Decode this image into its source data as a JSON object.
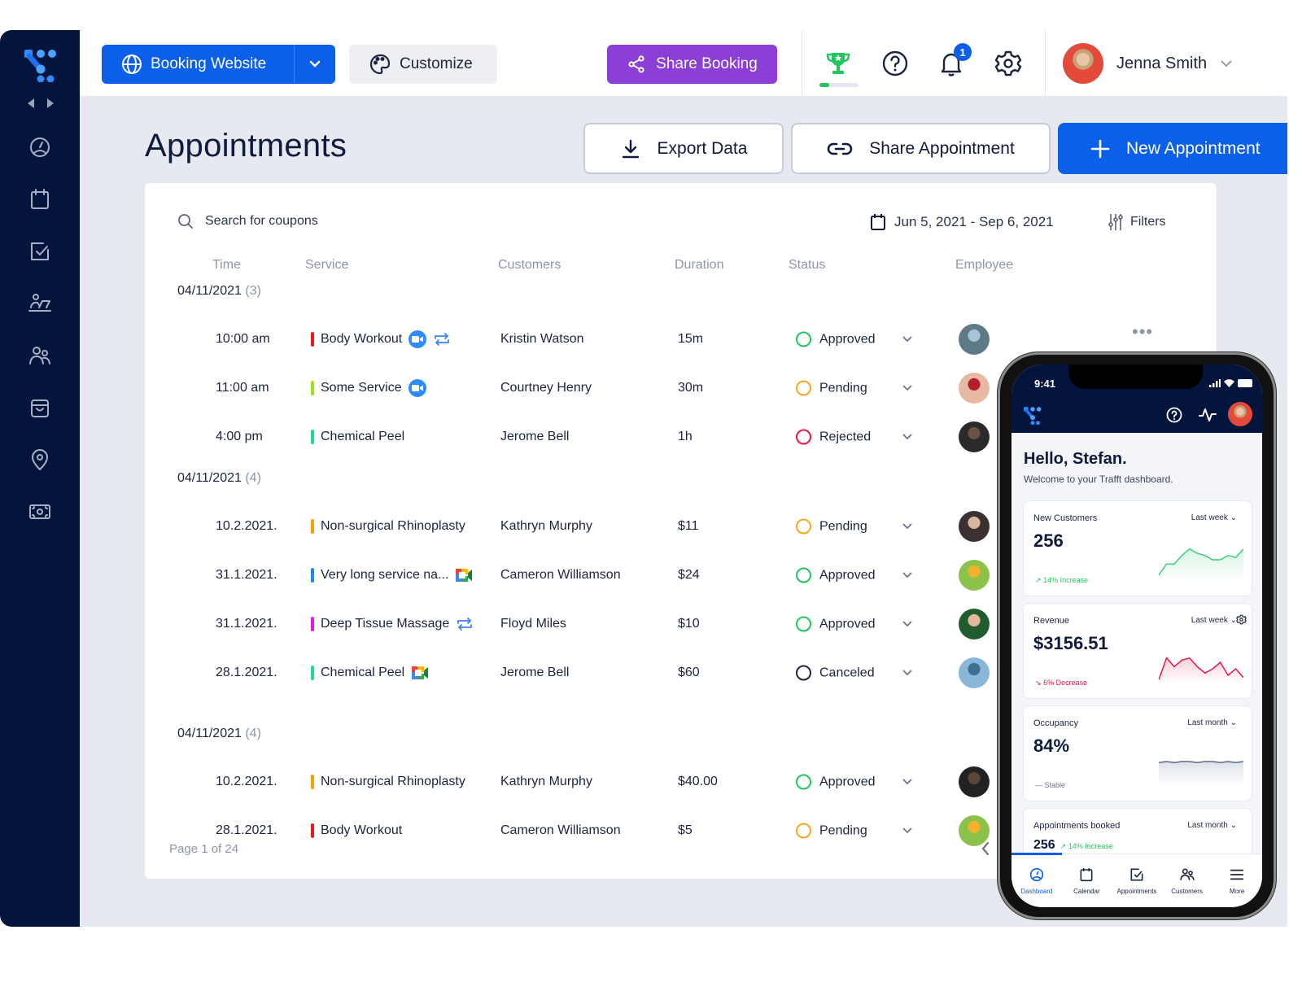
{
  "topbar": {
    "booking_website_label": "Booking Website",
    "customize_label": "Customize",
    "share_booking_label": "Share Booking",
    "achievement_progress": 0.25,
    "notification_count": "1",
    "user_name": "Jenna Smith"
  },
  "sidebar": {
    "items": [
      {
        "icon": "dashboard-gauge-icon"
      },
      {
        "icon": "calendar-icon"
      },
      {
        "icon": "appointments-check-icon"
      },
      {
        "icon": "employees-desk-icon"
      },
      {
        "icon": "customers-icon"
      },
      {
        "icon": "services-bag-icon"
      },
      {
        "icon": "location-pin-icon"
      },
      {
        "icon": "finance-money-icon"
      }
    ]
  },
  "page": {
    "title": "Appointments",
    "export_label": "Export Data",
    "share_appointment_label": "Share Appointment",
    "new_appointment_label": "New Appointment"
  },
  "toolbar": {
    "search_placeholder": "Search for coupons",
    "date_range": "Jun 5, 2021 - Sep 6, 2021",
    "filters_label": "Filters"
  },
  "table": {
    "columns": [
      "Time",
      "Service",
      "Customers",
      "Duration",
      "Status",
      "Employee"
    ],
    "groups": [
      {
        "date": "04/11/2021",
        "count": "(3)",
        "rows": [
          {
            "time": "10:00 am",
            "service": "Body Workout",
            "service_color": "#e11d1d",
            "icons": [
              "zoom",
              "recurring"
            ],
            "customer": "Kristin Watson",
            "duration": "15m",
            "status": "Approved",
            "status_color": "#22c55e"
          },
          {
            "time": "11:00 am",
            "service": "Some Service",
            "service_color": "#a3e01b",
            "icons": [
              "zoom"
            ],
            "customer": "Courtney Henry",
            "duration": "30m",
            "status": "Pending",
            "status_color": "#f5a623"
          },
          {
            "time": "4:00 pm",
            "service": "Chemical Peel",
            "service_color": "#20d98d",
            "icons": [],
            "customer": "Jerome Bell",
            "duration": "1h",
            "status": "Rejected",
            "status_color": "#e8174a"
          }
        ]
      },
      {
        "date": "04/11/2021",
        "count": "(4)",
        "rows": [
          {
            "time": "10.2.2021.",
            "service": "Non-surgical Rhinoplasty",
            "service_color": "#f0a500",
            "icons": [],
            "customer": "Kathryn Murphy",
            "duration": "$11",
            "status": "Pending",
            "status_color": "#f5a623"
          },
          {
            "time": "31.1.2021.",
            "service": "Very long service na...",
            "service_color": "#1a8cf0",
            "icons": [
              "meet"
            ],
            "customer": "Cameron Williamson",
            "duration": "$24",
            "status": "Approved",
            "status_color": "#22c55e"
          },
          {
            "time": "31.1.2021.",
            "service": "Deep Tissue Massage",
            "service_color": "#e21be0",
            "icons": [
              "recurring"
            ],
            "customer": "Floyd Miles",
            "duration": "$10",
            "status": "Approved",
            "status_color": "#22c55e"
          },
          {
            "time": "28.1.2021.",
            "service": "Chemical Peel",
            "service_color": "#20d98d",
            "icons": [
              "meet"
            ],
            "customer": "Jerome Bell",
            "duration": "$60",
            "status": "Canceled",
            "status_color": "#1b2540"
          }
        ]
      },
      {
        "date": "04/11/2021",
        "count": "(4)",
        "rows": [
          {
            "time": "10.2.2021.",
            "service": "Non-surgical Rhinoplasty",
            "service_color": "#f0a500",
            "icons": [],
            "customer": "Kathryn Murphy",
            "duration": "$40.00",
            "status": "Approved",
            "status_color": "#22c55e"
          },
          {
            "time": "28.1.2021.",
            "service": "Body Workout",
            "service_color": "#e11d1d",
            "icons": [],
            "customer": "Cameron Williamson",
            "duration": "$5",
            "status": "Pending",
            "status_color": "#f5a623"
          }
        ]
      }
    ],
    "pagination": "Page 1 of 24"
  },
  "phone": {
    "time": "9:41",
    "greeting": "Hello, Stefan.",
    "subtitle": "Welcome to your Trafft dashboard.",
    "cards": [
      {
        "label": "New Customers",
        "period": "Last week",
        "value": "256",
        "trend": "14% Increase",
        "trend_color": "#22c55e",
        "trend_arrow": "↗",
        "spark_color": "#3ecf7a",
        "spark": [
          4,
          14,
          14,
          22,
          28,
          24,
          22,
          18,
          18,
          22,
          20,
          28
        ]
      },
      {
        "label": "Revenue",
        "period": "Last week",
        "value": "$3156.51",
        "trend": "6% Decrease",
        "trend_color": "#e8174a",
        "trend_arrow": "↘",
        "spark_color": "#e8174a",
        "spark": [
          2,
          22,
          14,
          20,
          22,
          14,
          8,
          12,
          18,
          6,
          12,
          4
        ]
      },
      {
        "label": "Occupancy",
        "period": "Last month",
        "value": "84%",
        "trend": "Stable",
        "trend_color": "#6b7489",
        "trend_arrow": "—",
        "spark_color": "#5a6a8a",
        "spark": [
          20,
          21,
          20,
          21,
          21,
          20,
          21,
          21,
          20,
          21,
          20,
          21
        ]
      },
      {
        "label": "Appointments booked",
        "period": "Last month",
        "value": "256",
        "trend": "14% Increase",
        "trend_color": "#22c55e",
        "trend_arrow": "↗"
      }
    ],
    "nav": [
      {
        "label": "Dashboard",
        "active": true
      },
      {
        "label": "Calendar"
      },
      {
        "label": "Appointments"
      },
      {
        "label": "Customers"
      },
      {
        "label": "More"
      }
    ]
  }
}
